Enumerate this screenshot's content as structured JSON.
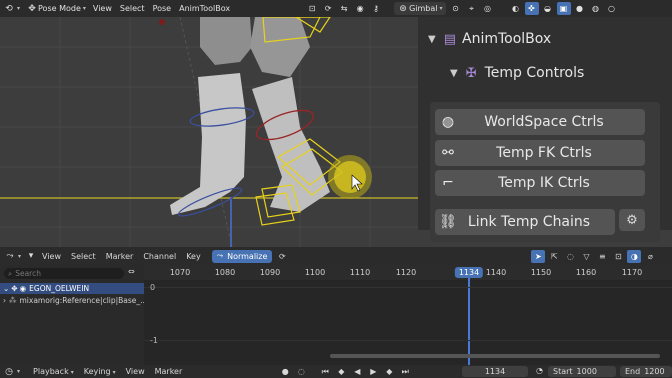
{
  "header": {
    "mode": "Pose Mode",
    "menus": [
      "View",
      "Select",
      "Pose",
      "AnimToolBox"
    ],
    "orientation": "Gimbal"
  },
  "npanel": {
    "addon_title": "AnimToolBox",
    "subpanel_title": "Temp Controls",
    "buttons": [
      {
        "label": "WorldSpace Ctrls",
        "icon": "globe-icon"
      },
      {
        "label": "Temp FK Ctrls",
        "icon": "bone-icon"
      },
      {
        "label": "Temp IK Ctrls",
        "icon": "ik-chain-icon"
      },
      {
        "label": "Link Temp Chains",
        "icon": "link-icon"
      }
    ]
  },
  "graph_editor": {
    "menus": [
      "View",
      "Select",
      "Marker",
      "Channel",
      "Key"
    ],
    "normalize_label": "Normalize",
    "search_placeholder": "Search",
    "channels": [
      {
        "label": "EGON_OELWEIN"
      },
      {
        "label": "mixamorig:Reference|clip|Base_..."
      }
    ],
    "ticks": [
      "1070",
      "1080",
      "1090",
      "1100",
      "1110",
      "1120",
      "1140",
      "1150",
      "1160",
      "1170"
    ],
    "current_frame": "1134",
    "value_labels": [
      "0",
      "-1"
    ]
  },
  "timeline_bar": {
    "menus": [
      "Playback",
      "Keying",
      "View",
      "Marker"
    ],
    "current_frame": "1134",
    "start_label": "Start",
    "start_value": "1000",
    "end_label": "End",
    "end_value": "1200"
  },
  "colors": {
    "accent": "#4772b3",
    "rig_yellow": "#e8d21a",
    "rig_red": "#9a2424",
    "rig_blue": "#3a4fa0"
  }
}
